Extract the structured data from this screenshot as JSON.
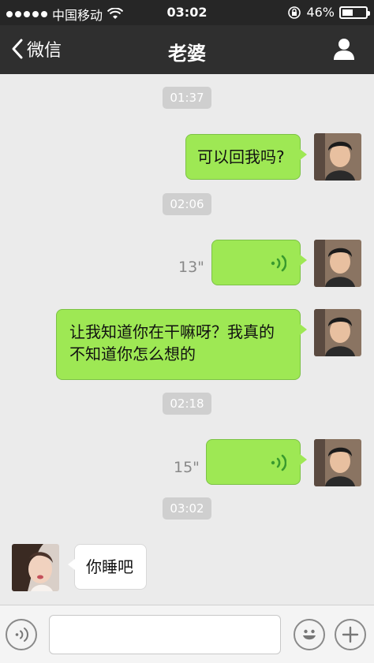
{
  "status_bar": {
    "carrier": "中国移动",
    "time": "03:02",
    "battery": "46%",
    "battery_level": 0.46
  },
  "nav": {
    "back_label": "微信",
    "title": "老婆",
    "profile_icon": "person-icon"
  },
  "messages": {
    "ts1": "01:37",
    "msg1": "可以回我吗?",
    "ts2": "02:06",
    "voice1_duration": "13\"",
    "msg2_line1": "让我知道你在干嘛呀？我真的",
    "msg2_line2": "不知道你怎么想的",
    "ts3": "02:18",
    "voice2_duration": "15\"",
    "ts4": "03:02",
    "reply": "你睡吧"
  },
  "input_bar": {
    "voice_icon": "voice-input-icon",
    "emoji_icon": "emoji-icon",
    "add_icon": "plus-icon",
    "text_value": ""
  },
  "colors": {
    "outgoing_bubble": "#9ee854",
    "voice_wave": "#3a9a2e",
    "nav_bg": "#2f2f2f"
  }
}
